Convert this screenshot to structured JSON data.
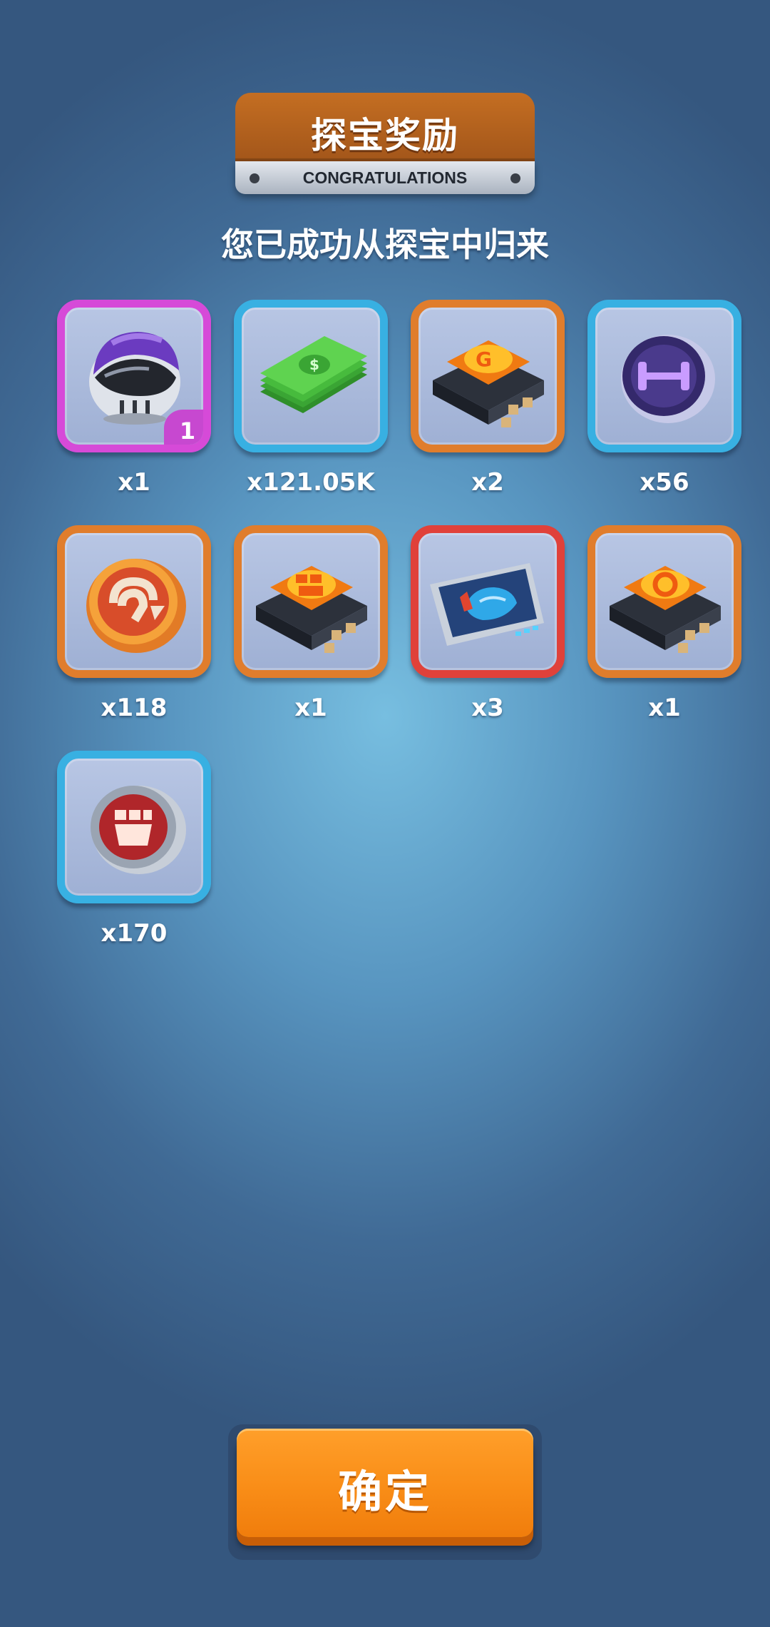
{
  "header": {
    "title": "探宝奖励",
    "subtitle": "CONGRATULATIONS"
  },
  "message": "您已成功从探宝中归来",
  "rewards": [
    {
      "icon": "helmet-icon",
      "quantity": "x1",
      "badge": "1",
      "frame": "purple"
    },
    {
      "icon": "cash-stack-icon",
      "quantity": "x121.05K",
      "frame": "blue"
    },
    {
      "icon": "chip-letter-icon",
      "quantity": "x2",
      "frame": "orange"
    },
    {
      "icon": "dumbbell-coin-icon",
      "quantity": "x56",
      "frame": "blue"
    },
    {
      "icon": "orange-token-icon",
      "quantity": "x118",
      "frame": "orange"
    },
    {
      "icon": "chip-fist-icon",
      "quantity": "x1",
      "frame": "orange"
    },
    {
      "icon": "blueprint-card-icon",
      "quantity": "x3",
      "frame": "red"
    },
    {
      "icon": "chip-gear-icon",
      "quantity": "x1",
      "frame": "orange"
    },
    {
      "icon": "fist-coin-icon",
      "quantity": "x170",
      "frame": "blue"
    }
  ],
  "confirm_label": "确定"
}
